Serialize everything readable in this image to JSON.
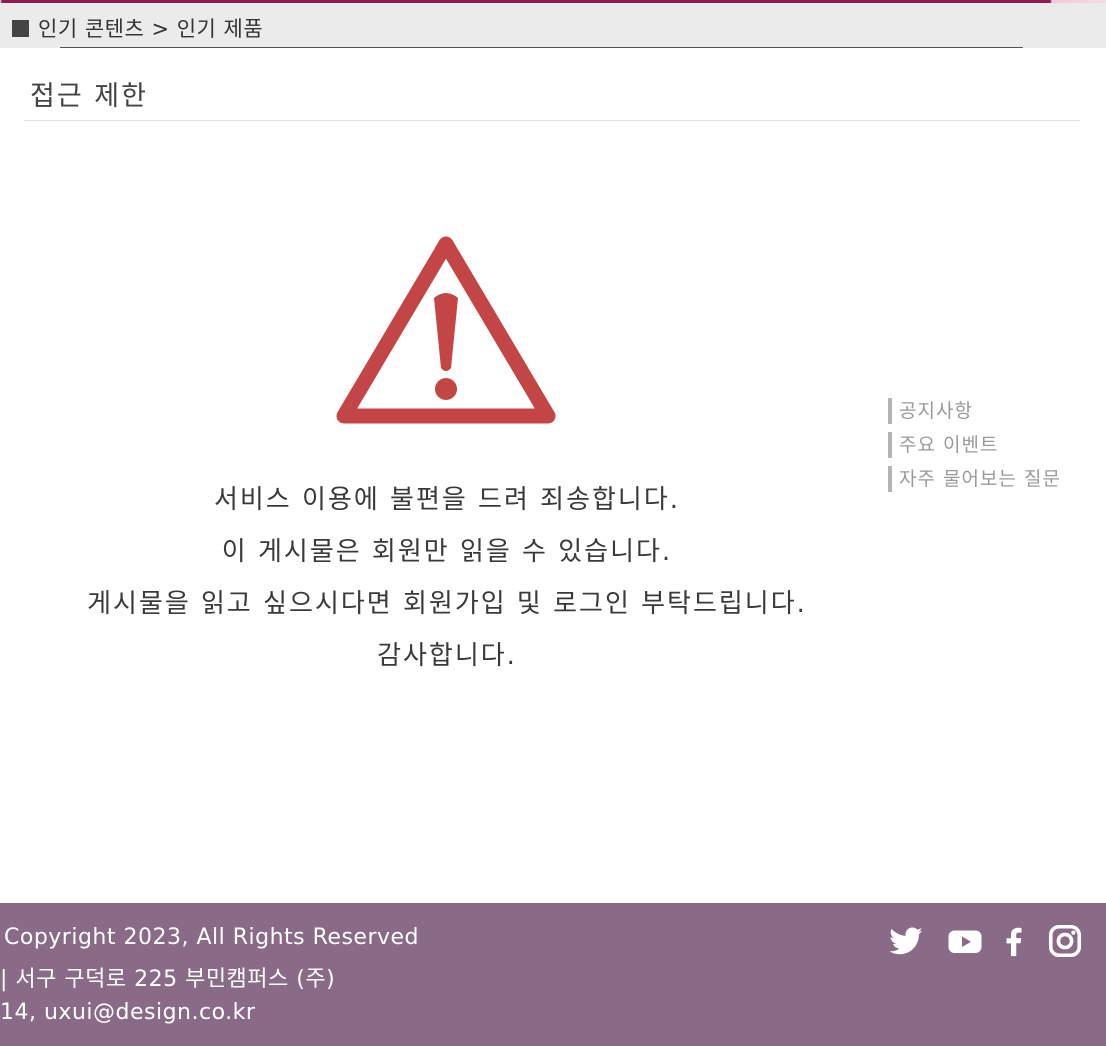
{
  "breadcrumb": {
    "text": "인기 콘텐츠 > 인기 제품"
  },
  "page": {
    "title": "접근 제한"
  },
  "notice": {
    "icon": "warning-triangle-icon",
    "icon_color": "#c44545",
    "lines": [
      "서비스 이용에 불편을 드려 죄송합니다.",
      "이 게시물은 회원만 읽을 수 있습니다.",
      "게시물을 읽고 싶으시다면 회원가입 및 로그인 부탁드립니다.",
      "감사합니다."
    ]
  },
  "side_links": [
    "공지사항",
    "주요 이벤트",
    "자주 물어보는 질문"
  ],
  "footer": {
    "background": "#8a6b87",
    "copyright": "Copyright 2023, All Rights Reserved",
    "address": "| 서구 구덕로 225 부민캠퍼스 (주)",
    "contact": "14, uxui@design.co.kr",
    "social_icons": [
      "twitter-icon",
      "youtube-icon",
      "facebook-icon",
      "instagram-icon"
    ]
  },
  "colors": {
    "accent": "#8a1f4f",
    "breadcrumb_bg": "#ebebeb",
    "side_link_border": "#b5b5b5"
  }
}
